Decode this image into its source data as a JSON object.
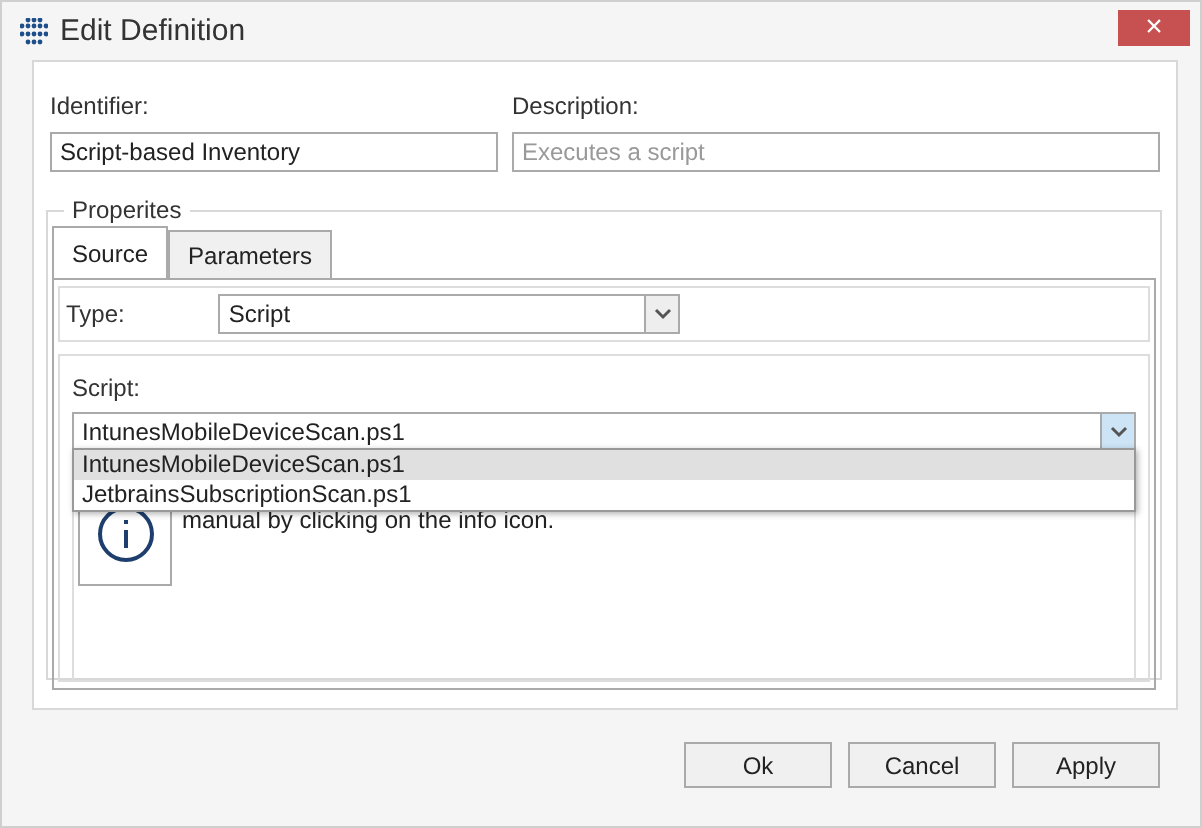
{
  "window": {
    "title": "Edit Definition",
    "close": "×"
  },
  "identifier": {
    "label": "Identifier:",
    "value": "Script-based Inventory"
  },
  "description": {
    "label": "Description:",
    "placeholder": "Executes a script"
  },
  "properties": {
    "legend": "Properites",
    "tabs": [
      {
        "label": "Source",
        "selected": true
      },
      {
        "label": "Parameters",
        "selected": false
      }
    ],
    "type": {
      "label": "Type:",
      "value": "Script"
    },
    "script": {
      "label": "Script:",
      "value": "IntunesMobileDeviceScan.ps1",
      "expanded": true,
      "options": [
        {
          "label": "IntunesMobileDeviceScan.ps1",
          "selected": true
        },
        {
          "label": "JetbrainsSubscriptionScan.ps1",
          "selected": false
        }
      ]
    },
    "info_text": "manual by clicking on the info icon."
  },
  "buttons": [
    "Ok",
    "Cancel",
    "Apply"
  ]
}
